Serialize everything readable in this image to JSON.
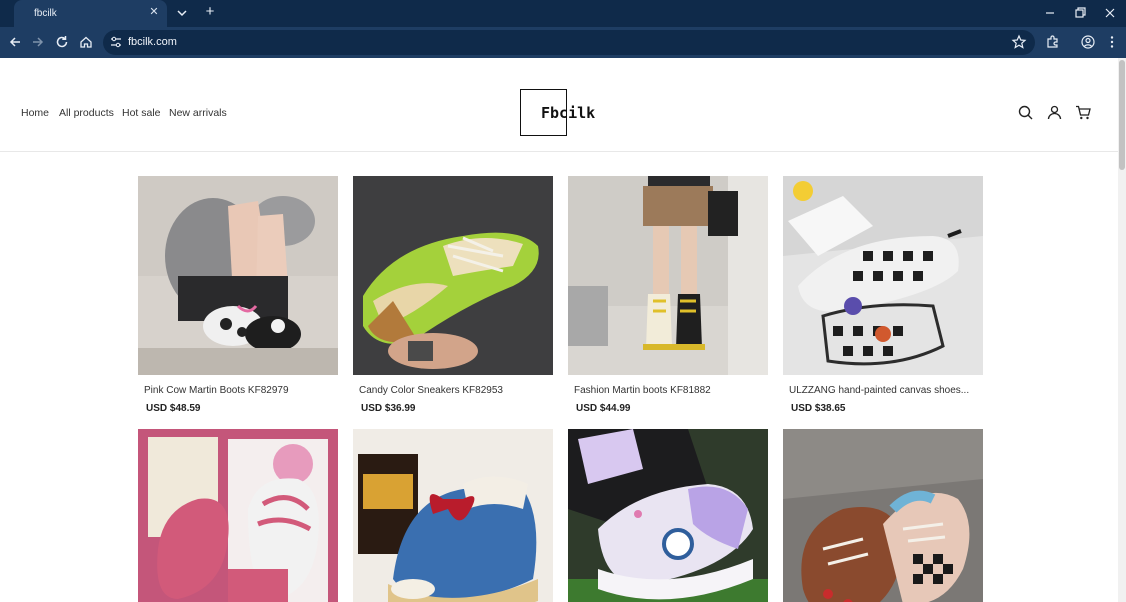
{
  "browser": {
    "tab_title": "fbcilk",
    "url": "fbcilk.com"
  },
  "nav": {
    "home": "Home",
    "all_products": "All products",
    "hot_sale": "Hot sale",
    "new_arrivals": "New arrivals"
  },
  "logo": {
    "text": "Fbcilk"
  },
  "products": [
    {
      "name": "Pink Cow Martin Boots KF82979",
      "price": "USD $48.59"
    },
    {
      "name": "Candy Color Sneakers KF82953",
      "price": "USD $36.99"
    },
    {
      "name": "Fashion Martin boots KF81882",
      "price": "USD $44.99"
    },
    {
      "name": "ULZZANG hand-painted canvas shoes...",
      "price": "USD $38.65"
    },
    {
      "name": "",
      "price": ""
    },
    {
      "name": "",
      "price": ""
    },
    {
      "name": "",
      "price": ""
    },
    {
      "name": "",
      "price": ""
    }
  ],
  "colors": {
    "browser_frame": "#0f2a4a",
    "browser_toolbar": "#1e3d63"
  },
  "icons": [
    "search-icon",
    "account-icon",
    "cart-icon"
  ]
}
